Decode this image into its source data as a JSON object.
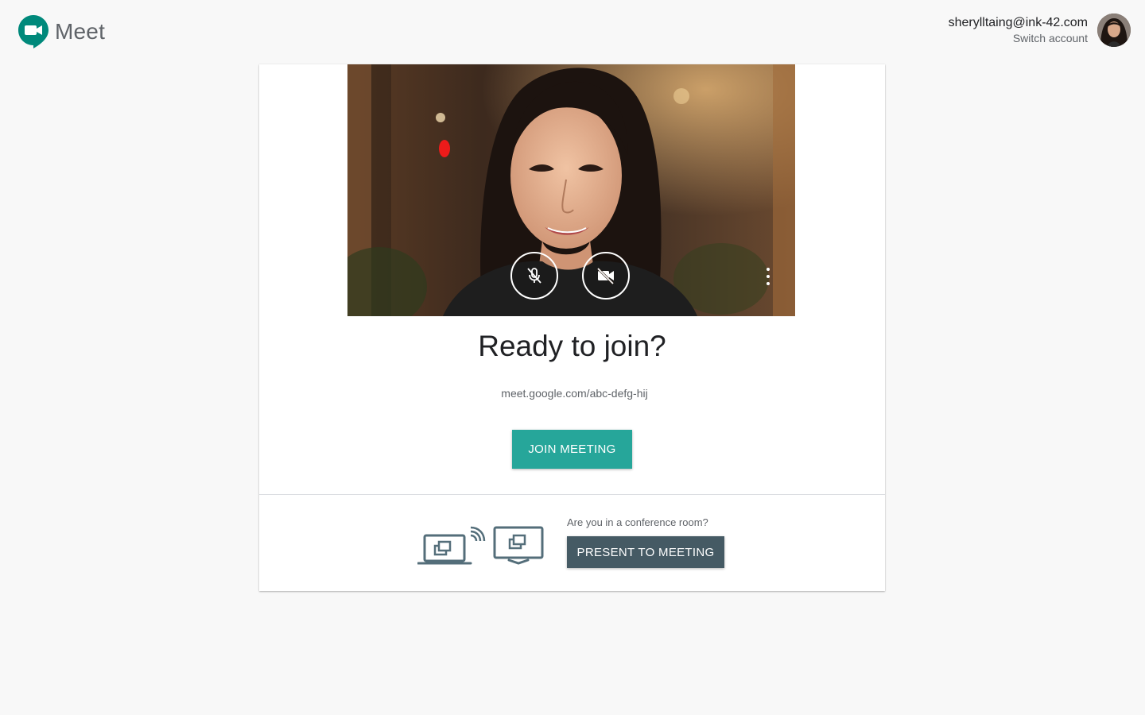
{
  "app": {
    "name": "Meet"
  },
  "account": {
    "email": "sherylltaing@ink-42.com",
    "switch_label": "Switch account"
  },
  "preview": {
    "mic_state": "muted",
    "camera_state": "off"
  },
  "main": {
    "title": "Ready to join?",
    "meeting_url": "meet.google.com/abc-defg-hij",
    "join_label": "JOIN MEETING"
  },
  "conference": {
    "question": "Are you in a conference room?",
    "present_label": "PRESENT TO MEETING"
  },
  "colors": {
    "join_button": "#26a69a",
    "present_button": "#455a64",
    "background": "#f8f8f8",
    "meet_logo_teal": "#00897b"
  },
  "icons": {
    "logo": "meet-logo-icon",
    "mic": "mic-off-icon",
    "camera": "videocam-off-icon",
    "more": "more-vert-icon",
    "devices": "cast-devices-icon"
  }
}
